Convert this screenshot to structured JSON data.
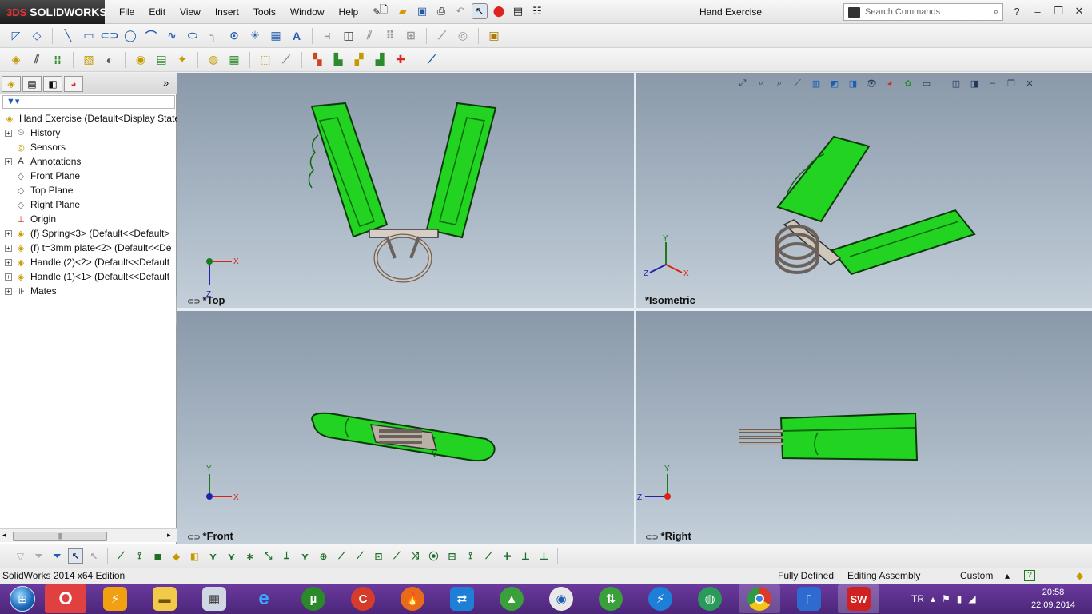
{
  "app": {
    "brand": "SOLIDWORKS",
    "brand_prefix": "3DS",
    "document_title": "Hand Exercise"
  },
  "menu": [
    "File",
    "Edit",
    "View",
    "Insert",
    "Tools",
    "Window",
    "Help"
  ],
  "search": {
    "placeholder": "Search Commands"
  },
  "quick_icons": [
    "new-document-icon",
    "open-icon",
    "save-icon",
    "print-icon",
    "undo-icon",
    "select-icon",
    "rebuild-icon",
    "file-properties-icon",
    "options-icon"
  ],
  "toolbar1_icons": [
    "smart-dimension-icon",
    "sketch-tool-icon",
    "line-icon",
    "rectangle-icon",
    "slot-icon",
    "circle-icon",
    "arc-icon",
    "spline-icon",
    "ellipse-icon",
    "fillet-icon",
    "plane-icon",
    "point-icon",
    "text-icon",
    "mirror-icon",
    "offset-icon",
    "convert-entities-icon",
    "pattern-icon",
    "move-entities-icon",
    "relations-icon",
    "repair-icon",
    "rapid-sketch-icon"
  ],
  "toolbar2_icons": [
    "insert-components-icon",
    "mate-icon",
    "linear-pattern-icon",
    "smart-fasteners-icon",
    "move-component-icon",
    "show-hidden-icon",
    "assembly-features-icon",
    "reference-geometry-icon",
    "new-motion-study-icon",
    "bill-of-materials-icon",
    "exploded-view-icon",
    "explode-line-sketch-icon",
    "interference-detection-icon",
    "clearance-verification-icon",
    "hole-alignment-icon",
    "measure-icon",
    "mass-properties-icon",
    "instant3d-icon"
  ],
  "feature_manager": {
    "tabs": [
      "feature-manager-icon",
      "property-manager-icon",
      "configuration-manager-icon",
      "display-manager-icon"
    ],
    "filter_icon": "filter-icon",
    "root": "Hand Exercise  (Default<Display State",
    "items": [
      {
        "label": "History",
        "icon": "history-icon",
        "expandable": true
      },
      {
        "label": "Sensors",
        "icon": "sensor-icon",
        "expandable": false
      },
      {
        "label": "Annotations",
        "icon": "annotations-icon",
        "expandable": true
      },
      {
        "label": "Front Plane",
        "icon": "plane-icon",
        "expandable": false
      },
      {
        "label": "Top Plane",
        "icon": "plane-icon",
        "expandable": false
      },
      {
        "label": "Right Plane",
        "icon": "plane-icon",
        "expandable": false
      },
      {
        "label": "Origin",
        "icon": "origin-icon",
        "expandable": false
      },
      {
        "label": "(f) Spring<3> (Default<<Default>",
        "icon": "part-icon",
        "expandable": true
      },
      {
        "label": "(f) t=3mm plate<2> (Default<<De",
        "icon": "part-icon",
        "expandable": true
      },
      {
        "label": "Handle (2)<2> (Default<<Default",
        "icon": "part-icon",
        "expandable": true
      },
      {
        "label": "Handle (1)<1> (Default<<Default",
        "icon": "part-icon",
        "expandable": true
      },
      {
        "label": "Mates",
        "icon": "mates-icon",
        "expandable": true
      }
    ]
  },
  "viewports": [
    {
      "name": "*Top",
      "axes": [
        "X",
        "Z"
      ]
    },
    {
      "name": "*Isometric",
      "axes": [
        "Y",
        "Z",
        "X"
      ]
    },
    {
      "name": "*Front",
      "axes": [
        "Y",
        "X"
      ]
    },
    {
      "name": "*Right",
      "axes": [
        "Y",
        "Z"
      ]
    }
  ],
  "heads_up_icons": [
    "zoom-to-fit-icon",
    "zoom-area-icon",
    "previous-view-icon",
    "section-view-icon",
    "dynamic-annotation-icon",
    "view-orientation-icon",
    "display-style-icon",
    "hide-show-icon",
    "edit-appearance-icon",
    "apply-scene-icon",
    "view-settings-icon"
  ],
  "viewport_controls": [
    "single-view-icon",
    "link-views-icon",
    "minimize-icon",
    "restore-icon",
    "close-icon"
  ],
  "selection_filter_icons": [
    "filter-toggle-icon",
    "clear-filters-icon",
    "select-all-filters-icon",
    "cursor-icon",
    "filter-vertices-icon",
    "filter-edges-icon",
    "filter-faces-icon",
    "filter-surface-bodies-icon",
    "filter-solid-bodies-icon",
    "filter-axes-icon",
    "filter-planes-icon",
    "filter-sketch-points-icon",
    "filter-sketch-segments-icon",
    "filter-midpoints-icon",
    "filter-center-marks-icon",
    "filter-centerline-icon",
    "filter-dimensions-icon",
    "filter-surface-finish-icon",
    "filter-geometric-tolerance-icon",
    "filter-notes-icon",
    "filter-weld-symbols-icon",
    "filter-datum-targets-icon",
    "filter-cosmetic-threads-icon",
    "filter-blocks-icon",
    "filter-dowel-pin-icon",
    "filter-connection-points-icon",
    "filter-routing-points-icon",
    "filter-mid-points-icon"
  ],
  "status": {
    "edition": "SolidWorks 2014 x64 Edition",
    "definition": "Fully Defined",
    "mode": "Editing Assembly",
    "units": "Custom"
  },
  "taskbar": {
    "apps": [
      "opera-icon",
      "winamp-icon",
      "explorer-folder-icon",
      "calculator-icon",
      "internet-explorer-icon",
      "utorrent-icon",
      "ccleaner-icon",
      "burning-studio-icon",
      "teamviewer-icon",
      "rocket-dock-icon",
      "media-player-icon",
      "lan-icon",
      "thunder-icon",
      "earth-icon",
      "chrome-icon",
      "phone-icon",
      "solidworks-icon"
    ],
    "language": "TR",
    "time": "20:58",
    "date": "22.09.2014"
  },
  "colors": {
    "handle_green": "#1fd81f",
    "viewport_bg": "#9aa9b8",
    "taskbar": "#5a2f8c",
    "accent_blue": "#1a5fb4"
  }
}
